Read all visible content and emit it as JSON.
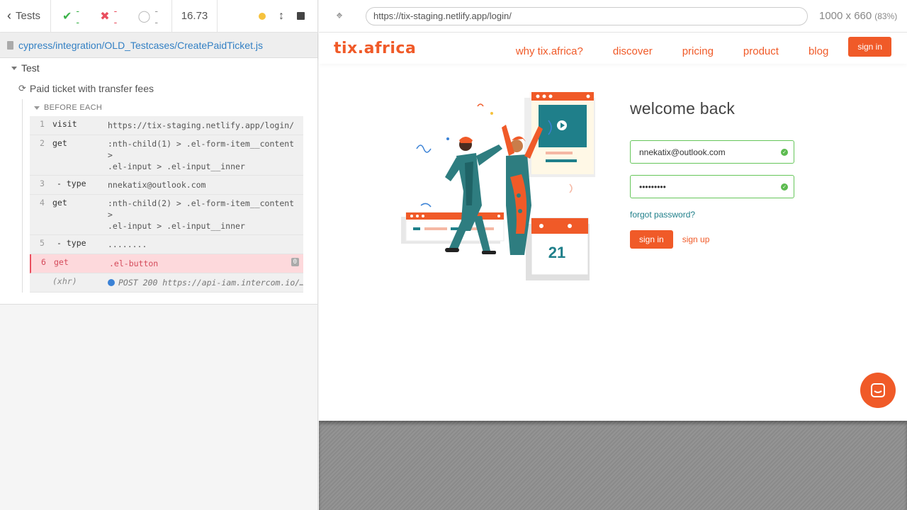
{
  "reporter": {
    "tests_label": "Tests",
    "passed": "--",
    "failed": "--",
    "pending": "--",
    "duration": "16.73",
    "spec_path": "cypress/integration/OLD_Testcases/CreatePaidTicket.js",
    "suite_title": "Test",
    "test_title": "Paid ticket with transfer fees",
    "hook_title": "BEFORE EACH",
    "commands": [
      {
        "num": "1",
        "name": "visit",
        "msg": "https://tix-staging.netlify.app/login/"
      },
      {
        "num": "2",
        "name": "get",
        "msg1": ":nth-child(1) > .el-form-item__content >",
        "msg2": ".el-input > .el-input__inner"
      },
      {
        "num": "3",
        "name": "- type",
        "msg": "nnekatix@outlook.com"
      },
      {
        "num": "4",
        "name": "get",
        "msg1": ":nth-child(2) > .el-form-item__content >",
        "msg2": ".el-input > .el-input__inner"
      },
      {
        "num": "5",
        "name": "- type",
        "msg": "........"
      },
      {
        "num": "6",
        "name": "get",
        "msg": ".el-button",
        "badge": "0"
      },
      {
        "num": "",
        "name": "(xhr)",
        "msg": "POST 200 https://api-iam.intercom.io/…"
      }
    ]
  },
  "browser": {
    "url": "https://tix-staging.netlify.app/login/",
    "viewport": "1000 x 660",
    "scale": "(83%)"
  },
  "site": {
    "logo": "tix.africa",
    "nav": [
      "why tix.africa?",
      "discover",
      "pricing",
      "product",
      "blog"
    ],
    "nav_signin": "sign in",
    "welcome": "welcome back",
    "email_value": "nnekatix@outlook.com",
    "password_value": "•••••••••",
    "forgot": "forgot password?",
    "signin_button": "sign in",
    "signup_link": "sign up",
    "calendar_day": "21"
  },
  "colors": {
    "brand": "#f05a28",
    "teal": "#1f7f8a",
    "pass": "#3cb34a",
    "fail": "#e94f5f"
  }
}
